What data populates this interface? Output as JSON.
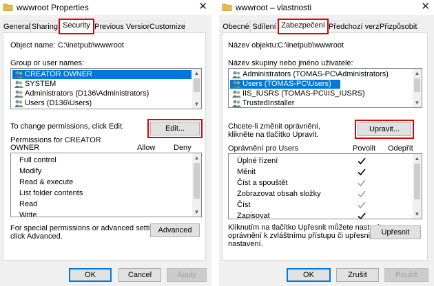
{
  "left": {
    "title": "wwwroot Properties",
    "tabs": [
      {
        "label": "General"
      },
      {
        "label": "Sharing"
      },
      {
        "label": "Security"
      },
      {
        "label": "Previous Versions"
      },
      {
        "label": "Customize"
      }
    ],
    "object_label": "Object name:",
    "object_value": "C:\\inetpub\\wwwroot",
    "group_label": "Group or user names:",
    "users": [
      {
        "name": "CREATOR OWNER"
      },
      {
        "name": "SYSTEM"
      },
      {
        "name": "Administrators (D136\\Administrators)"
      },
      {
        "name": "Users (D136\\Users)"
      }
    ],
    "change_text": "To change permissions, click Edit.",
    "edit_label": "Edit...",
    "perm_header_1": "Permissions for CREATOR",
    "perm_header_2": "OWNER",
    "allow_label": "Allow",
    "deny_label": "Deny",
    "permissions": [
      {
        "name": "Full control"
      },
      {
        "name": "Modify"
      },
      {
        "name": "Read & execute"
      },
      {
        "name": "List folder contents"
      },
      {
        "name": "Read"
      },
      {
        "name": "Write"
      }
    ],
    "special_text_1": "For special permissions or advanced settings,",
    "special_text_2": "click Advanced.",
    "advanced_label": "Advanced",
    "ok_label": "OK",
    "cancel_label": "Cancel",
    "apply_label": "Apply"
  },
  "right": {
    "title": "wwwroot – vlastnosti",
    "tabs": [
      {
        "label": "Obecné"
      },
      {
        "label": "Sdílení"
      },
      {
        "label": "Zabezpečení"
      },
      {
        "label": "Předchozí verze"
      },
      {
        "label": "Přizpůsobit"
      }
    ],
    "object_label": "Název objektu:",
    "object_value": "C:\\inetpub\\wwwroot",
    "group_label": "Název skupiny nebo jméno uživatele:",
    "users": [
      {
        "name": "Administrators (TOMAS-PC\\Administrators)"
      },
      {
        "name": "Users (TOMAS-PC\\Users)"
      },
      {
        "name": "IIS_IUSRS (TOMAS-PC\\IIS_IUSRS)"
      },
      {
        "name": "TrustedInstaller"
      }
    ],
    "change_text_1": "Chcete-li změnit oprávnění,",
    "change_text_2": "klikněte na tlačítko Upravit.",
    "edit_label": "Upravit...",
    "perm_header": "Oprávnění pro Users",
    "allow_label": "Povolit",
    "deny_label": "Odepřít",
    "permissions": [
      {
        "name": "Úplné řízení",
        "allow": false
      },
      {
        "name": "Měnit",
        "allow": true
      },
      {
        "name": "Číst a spouštět",
        "allow": true
      },
      {
        "name": "Zobrazovat obsah složky",
        "allow": true
      },
      {
        "name": "Číst",
        "allow": true
      },
      {
        "name": "Zapisovat",
        "allow": true
      }
    ],
    "special_text_1": "Kliknutím na tlačítko Upřesnit můžete nastavit",
    "special_text_2": "oprávnění k zvláštnímu přístupu či upřesnit",
    "special_text_3": "nastavení.",
    "advanced_label": "Upřesnit",
    "ok_label": "OK",
    "cancel_label": "Zrušit",
    "apply_label": "Použít"
  },
  "colors": {
    "selection": "#0078d7",
    "highlight_box": "#e00000",
    "check_dark": "#000000",
    "check_grey": "#a0a0a0"
  }
}
